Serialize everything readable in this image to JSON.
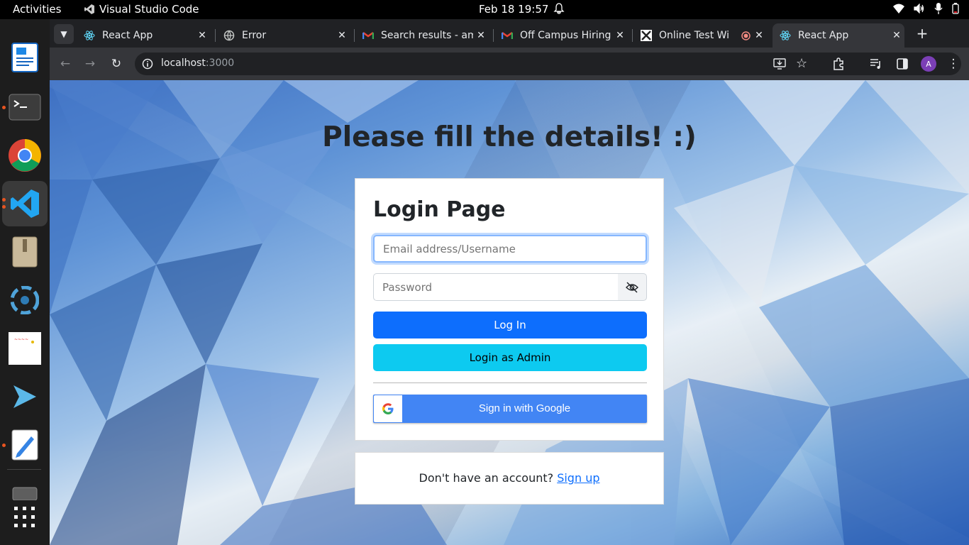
{
  "topbar": {
    "activities": "Activities",
    "app_name": "Visual Studio Code",
    "clock": "Feb 18  19:57"
  },
  "dock": {
    "items": [
      "writer-icon",
      "terminal-icon",
      "chrome-icon",
      "vscode-icon",
      "archive-icon",
      "app-icon",
      "image-icon",
      "remote-icon",
      "text-editor-icon",
      "files-icon",
      "apps-grid-icon"
    ]
  },
  "browser": {
    "tabs": [
      {
        "title": "React App",
        "icon": "react-icon"
      },
      {
        "title": "Error",
        "icon": "globe-icon"
      },
      {
        "title": "Search results - am",
        "icon": "gmail-icon"
      },
      {
        "title": "Off Campus Hiring",
        "icon": "gmail-icon"
      },
      {
        "title": "Online Test Wi",
        "icon": "test-icon"
      },
      {
        "title": "React App",
        "icon": "react-icon",
        "active": true
      }
    ],
    "url_host": "localhost",
    "url_port": ":3000",
    "avatar_letter": "A"
  },
  "page": {
    "heading": "Please fill the details! :)",
    "card_title": "Login Page",
    "email_placeholder": "Email address/Username",
    "password_placeholder": "Password",
    "login_button": "Log In",
    "admin_button": "Login as Admin",
    "google_button": "Sign in with Google",
    "signup_prompt": "Don't have an account? ",
    "signup_link": "Sign up"
  },
  "colors": {
    "primary": "#0d6efd",
    "info": "#0dcaf0",
    "google_blue": "#4285f4",
    "ubuntu_orange": "#e95420"
  }
}
